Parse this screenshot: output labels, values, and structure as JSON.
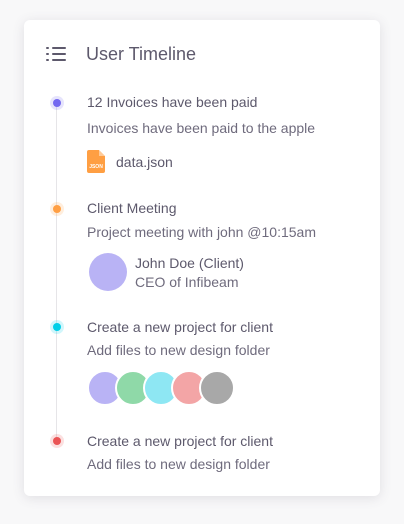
{
  "card": {
    "title": "User Timeline",
    "icon": "list-icon"
  },
  "events": [
    {
      "title": "12 Invoices have been paid",
      "subtitle": "Invoices have been paid to the apple",
      "dot_color": "#7367f0",
      "file": {
        "name": "data.json",
        "icon": "json-file-icon",
        "badge": "JSON",
        "color": "#ff9f43"
      }
    },
    {
      "title": "Client Meeting",
      "subtitle": "Project meeting with john @10:15am",
      "dot_color": "#ff9f43",
      "person": {
        "name": "John Doe (Client)",
        "role": "CEO of Infibeam",
        "avatar_color": "#b9b3f5"
      }
    },
    {
      "title": "Create a new project for client",
      "subtitle": "Add files to new design folder",
      "dot_color": "#00cfe8",
      "avatars": [
        "#b9b3f5",
        "#8fd9a8",
        "#8ee7f3",
        "#f3a5a6",
        "#a8a8a8"
      ]
    },
    {
      "title": "Create a new project for client",
      "subtitle": "Add files to new design folder",
      "dot_color": "#ea5455"
    }
  ]
}
